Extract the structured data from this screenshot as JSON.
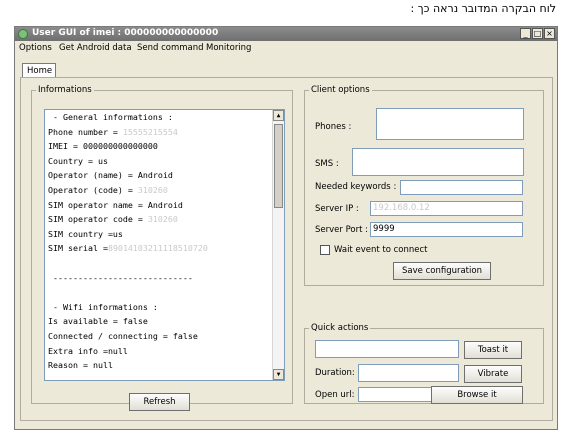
{
  "caption": "לוח הבקרה המדובר נראה כך :",
  "window": {
    "title": "User GUI of imei : 000000000000000",
    "controls": {
      "minimize": "_",
      "maximize": "□",
      "close": "×"
    }
  },
  "menu": [
    "Options",
    "Get Android data",
    "Send command",
    "Monitoring"
  ],
  "tabs": [
    {
      "label": "Home"
    }
  ],
  "informations": {
    "legend": "Informations",
    "lines": [
      " - General informations :",
      "Phone number = ",
      "IMEI = 000000000000000",
      "Country = us",
      "Operator (name) = Android",
      "Operator (code) = ",
      "SIM operator name = Android",
      "SIM operator code = ",
      "SIM country =us",
      "SIM serial =",
      "",
      " ----------------------------",
      "",
      " - Wifi informations :",
      "Is available = false",
      "Connected / connecting = false",
      "Extra info =null",
      "Reason = null"
    ],
    "redacted": [
      "15555215554",
      "310260",
      "310260",
      "89014103211118510720"
    ],
    "refresh_label": "Refresh"
  },
  "client_options": {
    "legend": "Client options",
    "phones_label": "Phones :",
    "sms_label": "SMS :",
    "keywords_label": "Needed keywords :",
    "server_ip_label": "Server IP :",
    "server_ip_value": "192.168.0.12",
    "server_port_label": "Server Port :",
    "server_port_value": "9999",
    "wait_event_label": "Wait event to connect",
    "wait_event_checked": false,
    "save_label": "Save configuration"
  },
  "quick_actions": {
    "legend": "Quick actions",
    "toast_label": "Toast it",
    "duration_label": "Duration:",
    "vibrate_label": "Vibrate",
    "open_url_label": "Open url:",
    "browse_label": "Browse it"
  }
}
